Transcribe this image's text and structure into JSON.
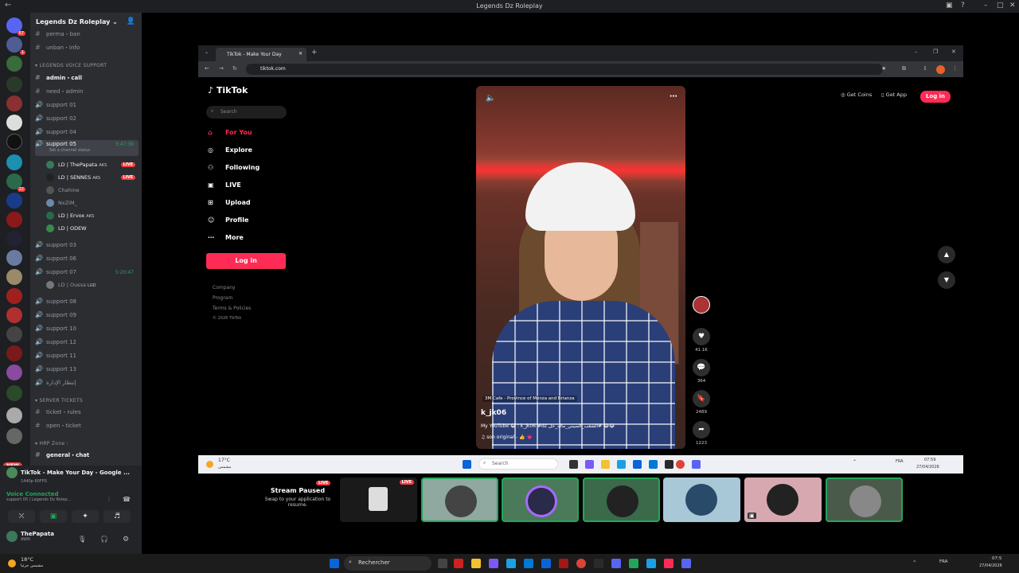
{
  "titlebar": {
    "title": "Legends Dz Roleplay"
  },
  "rail": {
    "badges": [
      "67",
      "1",
      "22"
    ],
    "new_label": "NEW"
  },
  "sidebar": {
    "server_name": "Legends Dz Roleplay",
    "channels": [
      {
        "label": "perma・ban",
        "y": 0
      },
      {
        "label": "unban・info",
        "y": 1
      }
    ],
    "cat_voice": "LEGENDS VOICE SUPPORT",
    "admin_call": "admin・call",
    "need_admin": "need・admin",
    "support_01": "support 01",
    "support_02": "support 02",
    "support_04": "support 04",
    "support_05": "support 05",
    "support_05_time": "3:47:39",
    "support_05_status": "Set a channel status",
    "voice_users": [
      {
        "name": "LD | ThePapata",
        "tag": "AKS",
        "live": "LIVE"
      },
      {
        "name": "LD | SENNES",
        "tag": "AKS",
        "live": "LIVE"
      },
      {
        "name": "Chahine",
        "tag": "",
        "live": ""
      },
      {
        "name": "NxZiM_",
        "tag": "",
        "live": ""
      },
      {
        "name": "LD | Ervox",
        "tag": "AKS",
        "live": ""
      },
      {
        "name": "LD | ODEW",
        "tag": "",
        "live": ""
      }
    ],
    "support_03": "support 03",
    "support_06": "support 06",
    "support_07": "support 07",
    "support_07_time": "5:20:47",
    "support_07_user": "LD | Oussa",
    "support_07_tag": "LGD",
    "support_08": "support 08",
    "support_09": "support 09",
    "support_10": "support 10",
    "support_12": "support 12",
    "support_11": "support 11",
    "support_13": "support 13",
    "idara": "إنتظار الإدارة",
    "cat_tickets": "SERVER TICKETS",
    "ticket_rules": "ticket・rules",
    "open_ticket": "open・ticket",
    "cat_hrp": "HRP Zone :",
    "general_chat": "general・chat"
  },
  "panel": {
    "activity": "TikTok - Make Your Day - Google ...",
    "activity_sub": "1440p 60FPS",
    "voice_connected": "Voice Connected",
    "voice_channel": "support 05 / Legends Dz Rolep...",
    "username": "ThePapata",
    "status": "AWN"
  },
  "browser": {
    "tab_title": "TikTok - Make Your Day",
    "url": "tiktok.com"
  },
  "tiktok": {
    "logo": "TikTok",
    "search_placeholder": "Search",
    "nav": [
      "For You",
      "Explore",
      "Following",
      "LIVE",
      "Upload",
      "Profile",
      "More"
    ],
    "login": "Log in",
    "footer": [
      "Company",
      "Program",
      "Terms & Policies",
      "© 2026 TikTok"
    ],
    "get_coins": "Get Coins",
    "get_app": "Get App",
    "login_top": "Log in",
    "video": {
      "location": "3M Cafe - Province of Monza and Brianza",
      "username": "k_jk06",
      "description": "My YouTube 😂 : k_jk06 #dz الشعب_الصيني_ماله_حل# 😂😂",
      "sound": "son original - 👍 💗"
    },
    "counts": {
      "likes": "41.1K",
      "comments": "364",
      "saves": "2489",
      "shares": "1223"
    }
  },
  "inner_taskbar": {
    "weather_temp": "17°C",
    "weather_text": "مشمس",
    "search": "Search",
    "lang": "FRA",
    "time": "07:59",
    "date": "27/04/2026"
  },
  "stream_tiles": {
    "paused_title": "Stream Paused",
    "paused_sub": "Swap to your application to resume.",
    "live": "LIVE"
  },
  "taskbar": {
    "weather_temp": "18°C",
    "weather_text": "مشمس جزئيا",
    "search": "Rechercher",
    "lang": "FRA",
    "time": "07:5",
    "date": "27/04/2026"
  },
  "colors": {
    "tiktok_red": "#fe2c55",
    "discord_green": "#23a55a",
    "live_red": "#f23f43"
  }
}
